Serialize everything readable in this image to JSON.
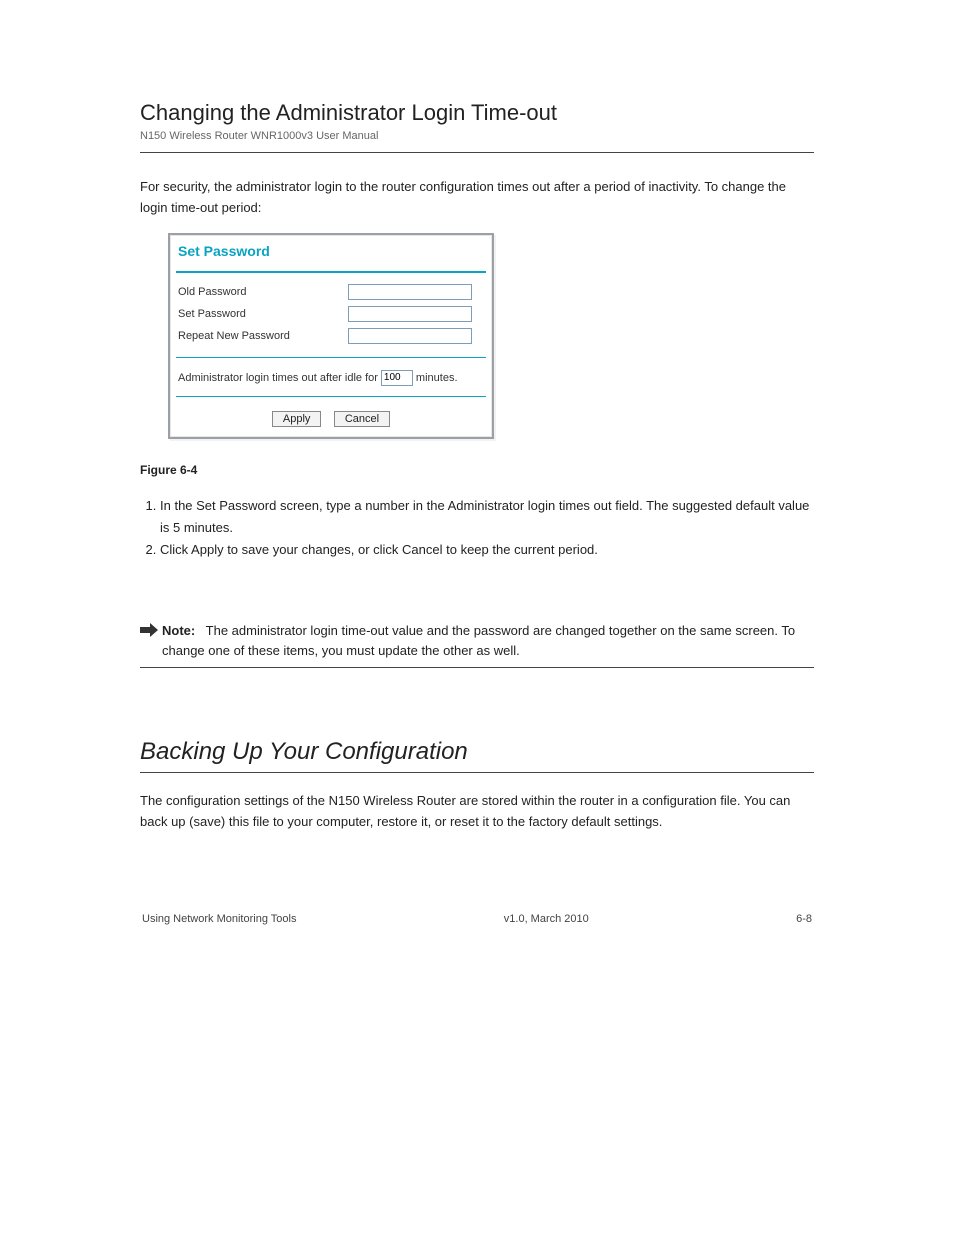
{
  "header": {
    "title": "Changing the Administrator Login Time-out",
    "book": "N150 Wireless Router WNR1000v3 User Manual"
  },
  "intro": "For security, the administrator login to the router configuration times out after a period of inactivity. To change the login time-out period:",
  "panel": {
    "title": "Set Password",
    "rows": {
      "old": "Old Password",
      "new": "Set Password",
      "repeat": "Repeat New Password"
    },
    "timeout_prefix": "Administrator login times out after idle for",
    "timeout_value": "100",
    "timeout_suffix": "minutes.",
    "buttons": {
      "apply": "Apply",
      "cancel": "Cancel"
    },
    "caption": "Figure 6-4"
  },
  "steps": [
    "In the Set Password screen, type a number in the Administrator login times out field. The suggested default value is 5 minutes.",
    "Click Apply to save your changes, or click Cancel to keep the current period."
  ],
  "note": {
    "label": "Note:",
    "text": "The administrator login time-out value and the password are changed together on the same screen. To change one of these items, you must update the other as well."
  },
  "section": {
    "title": "Backing Up Your Configuration",
    "body": "The configuration settings of the N150 Wireless Router are stored within the router in a configuration file. You can back up (save) this file to your computer, restore it, or reset it to the factory default settings."
  },
  "footer": {
    "left": "Using Network Monitoring Tools",
    "right": "6-8",
    "version": "v1.0, March 2010"
  }
}
